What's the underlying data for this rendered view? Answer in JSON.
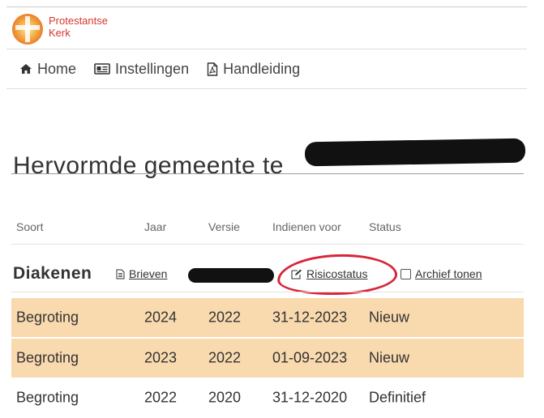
{
  "brand": {
    "line1": "Protestantse",
    "line2": "Kerk"
  },
  "nav": [
    {
      "label": "Home",
      "icon": "home-icon"
    },
    {
      "label": "Instellingen",
      "icon": "id-card-icon"
    },
    {
      "label": "Handleiding",
      "icon": "pdf-file-icon"
    }
  ],
  "page_title": "Hervormde gemeente te",
  "columns": [
    "Soort",
    "Jaar",
    "Versie",
    "Indienen voor",
    "Status"
  ],
  "section": {
    "title": "Diakenen",
    "links": {
      "brieven": "Brieven",
      "risicostatus": "Risicostatus",
      "archief": "Archief tonen"
    }
  },
  "rows": [
    {
      "soort": "Begroting",
      "jaar": "2024",
      "versie": "2022",
      "indienen": "31-12-2023",
      "status": "Nieuw",
      "highlight": true
    },
    {
      "soort": "Begroting",
      "jaar": "2023",
      "versie": "2022",
      "indienen": "01-09-2023",
      "status": "Nieuw",
      "highlight": true
    },
    {
      "soort": "Begroting",
      "jaar": "2022",
      "versie": "2020",
      "indienen": "31-12-2020",
      "status": "Definitief",
      "highlight": false
    }
  ],
  "colors": {
    "brand_red": "#d8372b",
    "logo_orange": "#f2a33a",
    "row_highlight": "#f9d9ae",
    "annotation_red": "#d8253b"
  }
}
